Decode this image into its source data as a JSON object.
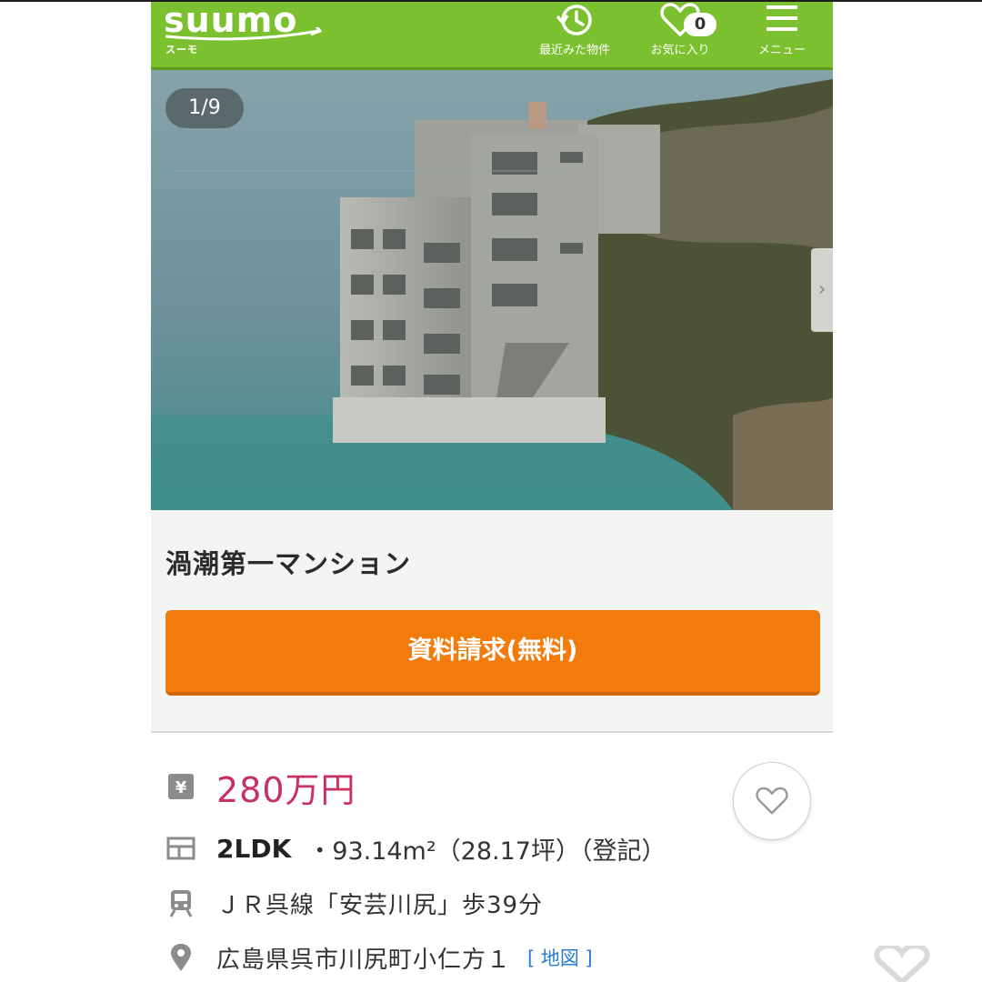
{
  "header": {
    "logo_text": "suumo",
    "logo_sub": "スーモ",
    "nav": {
      "history_label": "最近みた物件",
      "favorites_label": "お気に入り",
      "favorites_count": "0",
      "menu_label": "メニュー"
    }
  },
  "gallery": {
    "counter": "1/9",
    "next_icon": "chevron-right-icon"
  },
  "property": {
    "title": "渦潮第一マンション",
    "request_button": "資料請求(無料)"
  },
  "details": {
    "price": "280万円",
    "layout": "2LDK",
    "area": "・93.14m²（28.17坪）（登記）",
    "access": "ＪＲ呉線「安芸川尻」歩39分",
    "address": "広島県呉市川尻町小仁方１",
    "map_link": "[ 地図 ]"
  },
  "icons": {
    "price": "yen-icon",
    "layout": "floor-plan-icon",
    "access": "train-icon",
    "address": "map-pin-icon",
    "favorite": "heart-icon"
  },
  "colors": {
    "brand_green": "#7ac02f",
    "cta_orange": "#f27b0c",
    "price_pink": "#c7315d",
    "link_blue": "#2a7bd6"
  }
}
